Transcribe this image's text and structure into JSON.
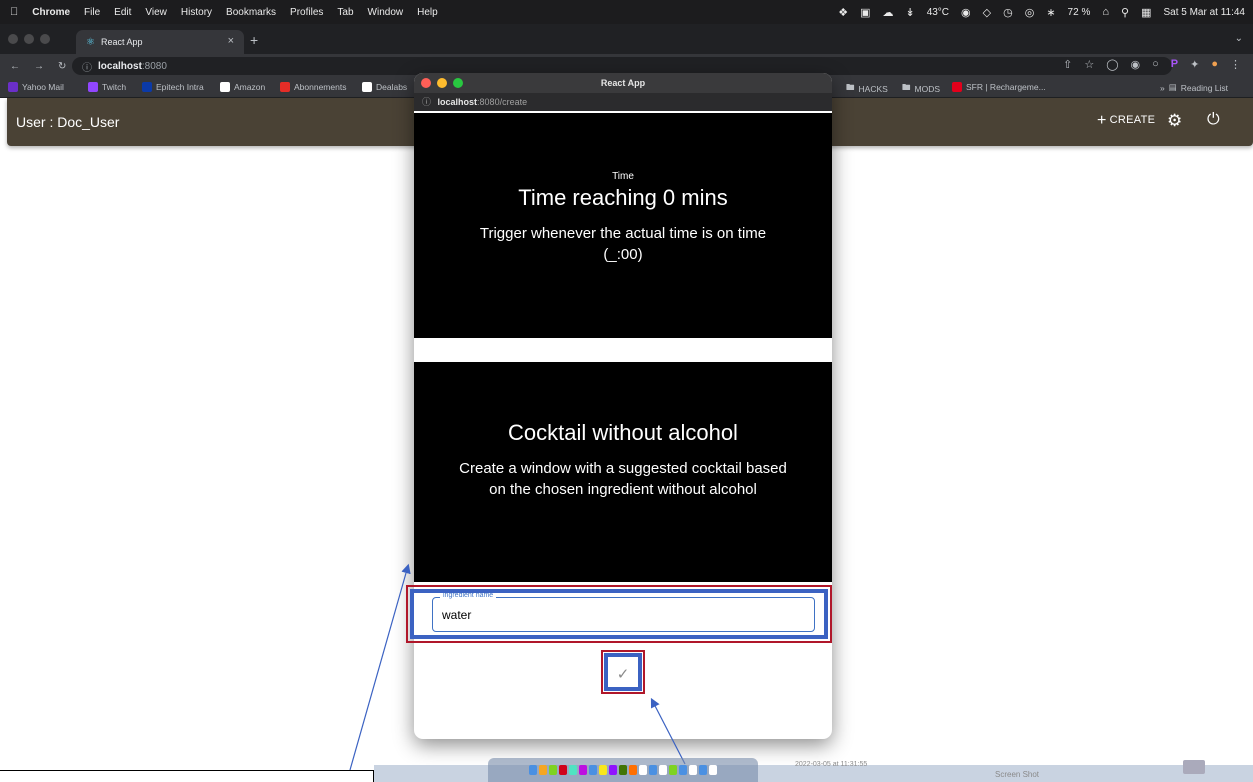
{
  "menubar": {
    "apple": "",
    "items": [
      "Chrome",
      "File",
      "Edit",
      "View",
      "History",
      "Bookmarks",
      "Profiles",
      "Tab",
      "Window",
      "Help"
    ],
    "temperature": "43°C",
    "battery": "72 %",
    "datetime": "Sat 5 Mar at 11:44"
  },
  "browser": {
    "tab_title": "React App",
    "url_host": "localhost",
    "url_port": ":8080",
    "bookmarks": [
      "Yahoo Mail",
      "Twitch",
      "Epitech Intra",
      "Amazon",
      "Abonnements",
      "Dealabs",
      "HACKS",
      "MODS",
      "SFR | Rechargeme...",
      "Reading List"
    ]
  },
  "appbar": {
    "user_label": "User : Doc_User",
    "create_label": "CREATE",
    "create_icon": "plus-icon",
    "settings_icon": "gear-icon",
    "logout_icon": "power-icon",
    "color": "#4a4235"
  },
  "popup": {
    "window_title": "React App",
    "url_host": "localhost",
    "url_path": ":8080/create",
    "trigger_card": {
      "category": "Time",
      "title": "Time reaching 0 mins",
      "description": "Trigger whenever the actual time is on time (_:00)"
    },
    "action_card": {
      "title": "Cocktail without alcohol",
      "description": "Create a window with a suggested cocktail based on the chosen ingredient without alcohol"
    },
    "ingredient_field": {
      "label": "ingredient name",
      "value": "water"
    },
    "submit_icon": "check-icon"
  },
  "desktop": {
    "dock_timestamp": "2022-03-05 at 11:31:55",
    "screenshot_label": "Screen Shot"
  },
  "colors": {
    "highlight_red": "#b0172a",
    "highlight_blue": "#3b62c2",
    "field_border": "#3f72c4"
  }
}
